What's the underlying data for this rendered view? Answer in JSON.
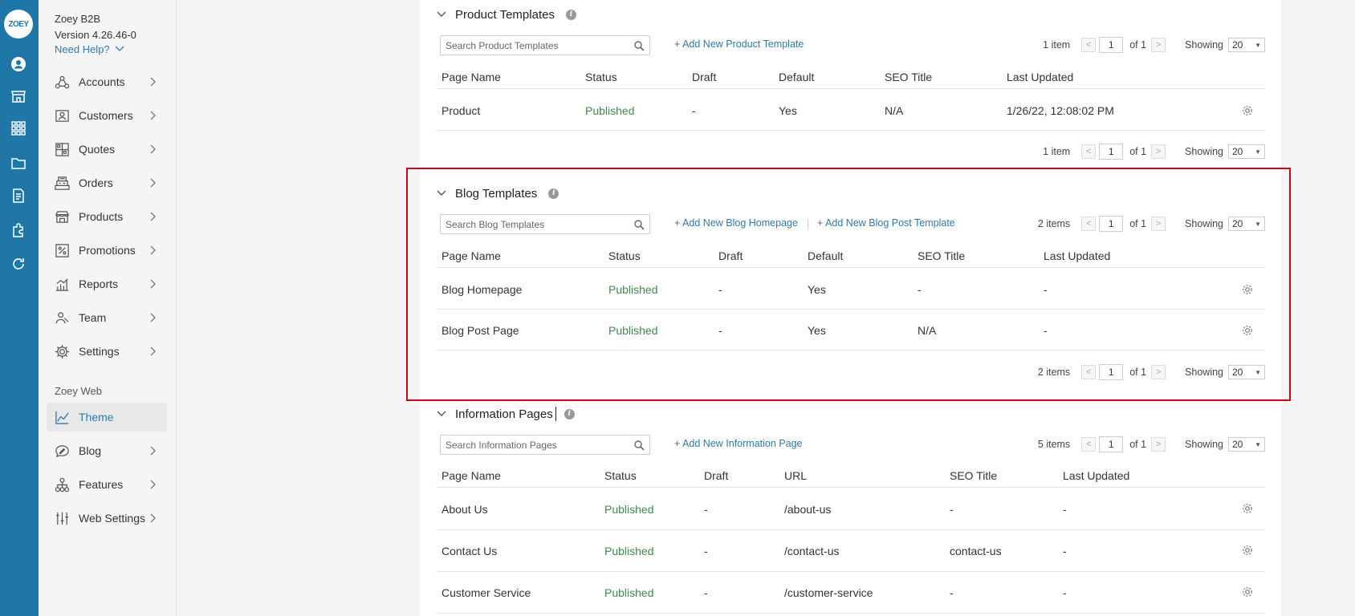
{
  "app": {
    "logo_text": "ZOEY",
    "name": "Zoey B2B",
    "version": "Version 4.26.46-0",
    "help": "Need Help?"
  },
  "sidebar": {
    "items": [
      {
        "label": "Accounts",
        "icon": "accounts-icon"
      },
      {
        "label": "Customers",
        "icon": "customers-icon"
      },
      {
        "label": "Quotes",
        "icon": "quotes-icon"
      },
      {
        "label": "Orders",
        "icon": "orders-icon"
      },
      {
        "label": "Products",
        "icon": "products-icon"
      },
      {
        "label": "Promotions",
        "icon": "promotions-icon"
      },
      {
        "label": "Reports",
        "icon": "reports-icon"
      },
      {
        "label": "Team",
        "icon": "team-icon"
      },
      {
        "label": "Settings",
        "icon": "settings-icon"
      }
    ],
    "web_section": "Zoey Web",
    "web_items": [
      {
        "label": "Theme",
        "icon": "theme-icon",
        "active": true
      },
      {
        "label": "Blog",
        "icon": "blog-icon"
      },
      {
        "label": "Features",
        "icon": "features-icon"
      },
      {
        "label": "Web Settings",
        "icon": "web-settings-icon"
      }
    ]
  },
  "product_templates": {
    "title": "Product Templates",
    "search_placeholder": "Search Product Templates",
    "add_link": "+ Add New Product Template",
    "pager": {
      "count": "1 item",
      "page": "1",
      "of": "of 1",
      "showing": "Showing",
      "per_page": "20"
    },
    "columns": [
      "Page Name",
      "Status",
      "Draft",
      "Default",
      "SEO Title",
      "Last Updated"
    ],
    "rows": [
      {
        "name": "Product",
        "status": "Published",
        "draft": "-",
        "default": "Yes",
        "seo": "N/A",
        "updated": "1/26/22, 12:08:02 PM"
      }
    ]
  },
  "blog_templates": {
    "title": "Blog Templates",
    "search_placeholder": "Search Blog Templates",
    "add_link_1": "+ Add New Blog Homepage",
    "add_link_2": "+ Add New Blog Post Template",
    "pager": {
      "count": "2 items",
      "page": "1",
      "of": "of 1",
      "showing": "Showing",
      "per_page": "20"
    },
    "columns": [
      "Page Name",
      "Status",
      "Draft",
      "Default",
      "SEO Title",
      "Last Updated"
    ],
    "rows": [
      {
        "name": "Blog Homepage",
        "status": "Published",
        "draft": "-",
        "default": "Yes",
        "seo": "-",
        "updated": "-"
      },
      {
        "name": "Blog Post Page",
        "status": "Published",
        "draft": "-",
        "default": "Yes",
        "seo": "N/A",
        "updated": "-"
      }
    ]
  },
  "information_pages": {
    "title": "Information Pages",
    "search_placeholder": "Search Information Pages",
    "add_link": "+ Add New Information Page",
    "pager": {
      "count": "5 items",
      "page": "1",
      "of": "of 1",
      "showing": "Showing",
      "per_page": "20"
    },
    "columns": [
      "Page Name",
      "Status",
      "Draft",
      "URL",
      "SEO Title",
      "Last Updated"
    ],
    "rows": [
      {
        "name": "About Us",
        "status": "Published",
        "draft": "-",
        "url": "/about-us",
        "seo": "-",
        "updated": "-"
      },
      {
        "name": "Contact Us",
        "status": "Published",
        "draft": "-",
        "url": "/contact-us",
        "seo": "contact-us",
        "updated": "-"
      },
      {
        "name": "Customer Service",
        "status": "Published",
        "draft": "-",
        "url": "/customer-service",
        "seo": "-",
        "updated": "-"
      }
    ]
  },
  "colors": {
    "rail": "#1f77a8",
    "link": "#2d7ab0",
    "published": "#3d8b4c",
    "highlight": "#d0021b"
  }
}
